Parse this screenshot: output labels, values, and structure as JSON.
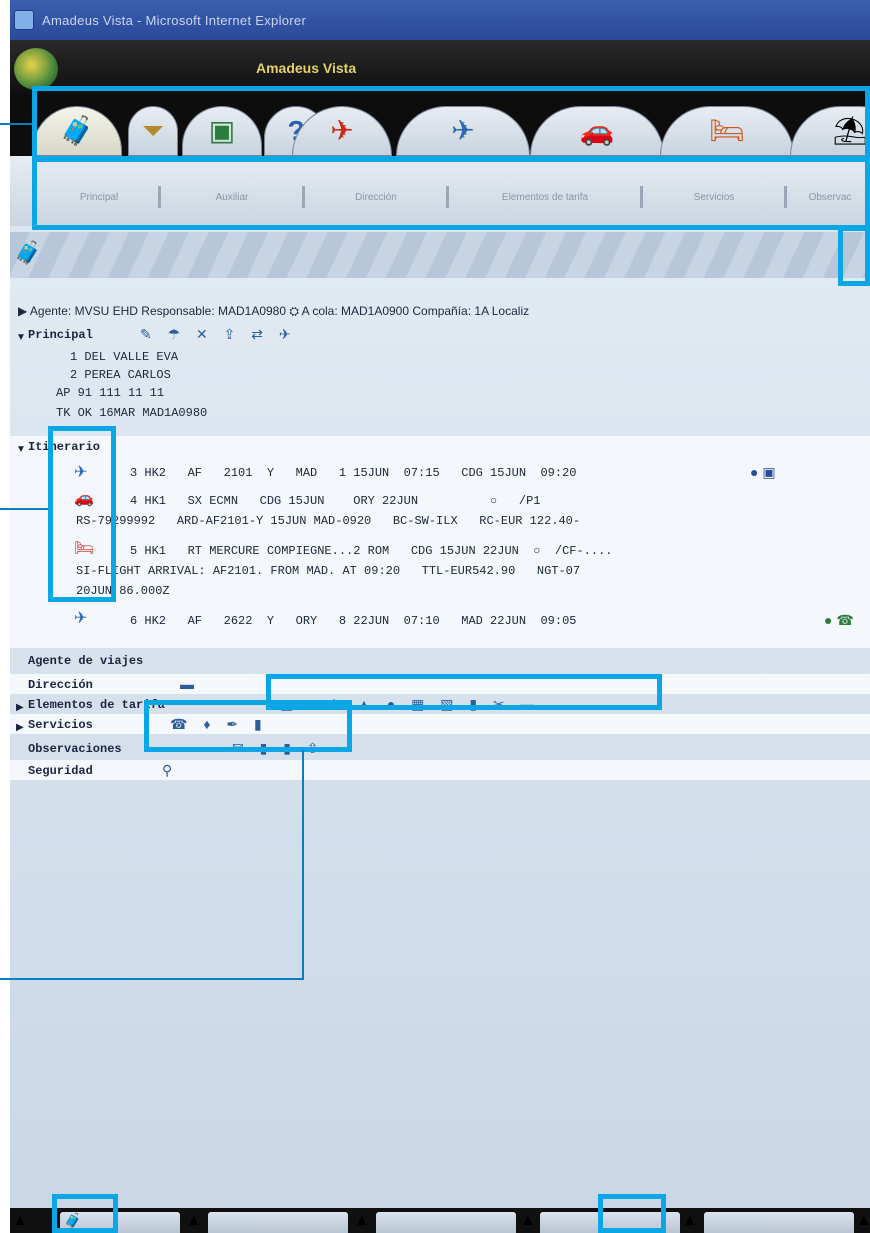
{
  "window": {
    "title": "Amadeus Vista - Microsoft Internet Explorer"
  },
  "app": {
    "title": "Amadeus Vista"
  },
  "tabs": [
    {
      "icon": "travel-agent-icon"
    },
    {
      "icon": "funnel-icon"
    },
    {
      "icon": "terminal-icon"
    },
    {
      "icon": "question-icon"
    },
    {
      "icon": "plane-red-icon"
    },
    {
      "icon": "airplane-icon"
    },
    {
      "icon": "car-icon"
    },
    {
      "icon": "hotel-icon"
    },
    {
      "icon": "beach-umbrella-icon"
    }
  ],
  "subtabs": [
    "Principal",
    "Auxiliar",
    "Dirección",
    "Elementos de tarifa",
    "Servicios",
    "Observac"
  ],
  "agent_line": "▶ Agente: MVSU EHD   Responsable: MAD1A0980   ⛭   A cola: MAD1A0900   Compañía: 1A   Localiz",
  "principal": {
    "label": "Principal",
    "lines": [
      "1 DEL VALLE EVA",
      "2 PEREA CARLOS",
      "AP 91 111 11 11",
      "TK OK 16MAR MAD1A0980"
    ]
  },
  "itinerario": {
    "label": "Itinerario",
    "lines": [
      "3 HK2   AF   2101  Y   MAD   1 15JUN  07:15   CDG 15JUN  09:20",
      "4 HK1   SX ECMN   CDG 15JUN    ORY 22JUN          ○   /P1",
      "RS-79299992   ARD-AF2101-Y 15JUN MAD-0920   BC-SW-ILX   RC-EUR 122.40-",
      "5 HK1   RT MERCURE COMPIEGNE...2 ROM   CDG 15JUN 22JUN  ○  /CF-....",
      "SI-FLIGHT ARRIVAL: AF2101. FROM MAD. AT 09:20   TTL-EUR542.90   NGT-07",
      "20JUN 86.000Z",
      "6 HK2   AF   2622  Y   ORY   8 22JUN  07:10   MAD 22JUN  09:05"
    ]
  },
  "sections": [
    {
      "label": "Agente de viajes",
      "arrow": ""
    },
    {
      "label": "Dirección",
      "arrow": ""
    },
    {
      "label": "Elementos de tarifa",
      "arrow": "▶"
    },
    {
      "label": "Servicios",
      "arrow": "▶"
    },
    {
      "label": "Observaciones",
      "arrow": ""
    },
    {
      "label": "Seguridad",
      "arrow": ""
    }
  ]
}
